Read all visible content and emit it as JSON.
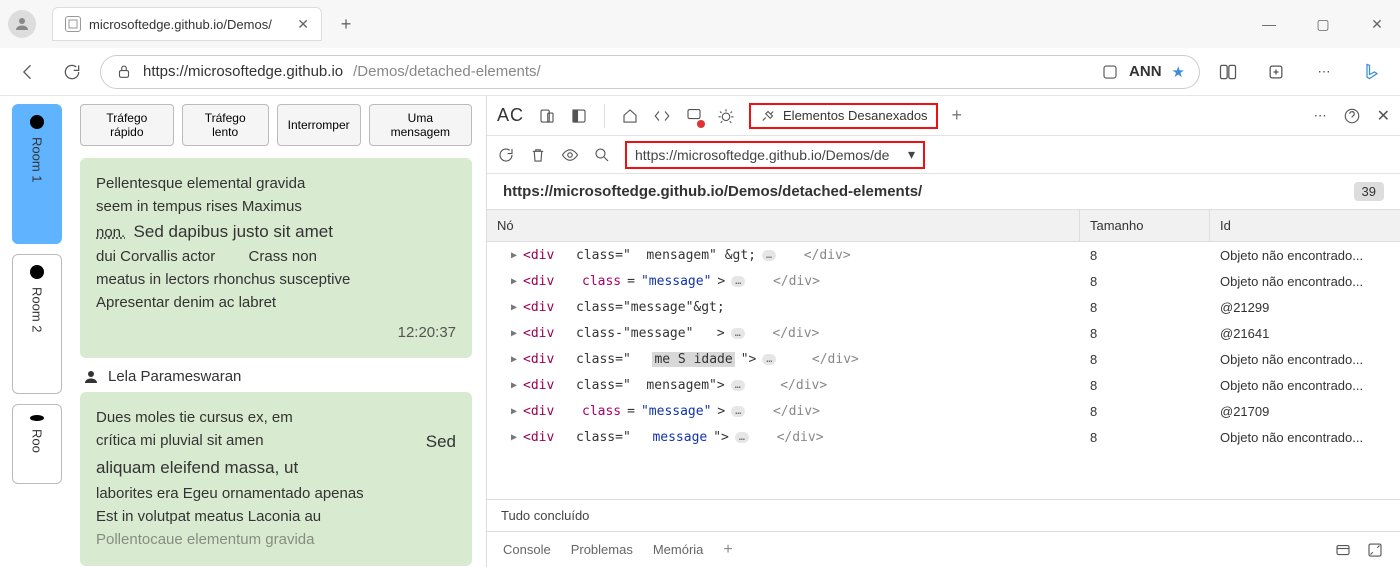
{
  "browser": {
    "tab_title": "microsoftedge.github.io/Demos/",
    "url_host": "https://microsoftedge.github.io",
    "url_path": "/Demos/detached-elements/",
    "profile_label": "ANN"
  },
  "app": {
    "rooms": [
      {
        "label": "Room 1",
        "active": true
      },
      {
        "label": "Room 2",
        "active": false
      },
      {
        "label": "Roo",
        "active": false
      }
    ],
    "buttons": {
      "fast": "Tráfego rápido",
      "slow": "Tráfego lento",
      "stop": "Interromper",
      "one": "Uma mensagem"
    },
    "msg1": {
      "line1": "Pellentesque elemental gravida",
      "line2": "seem in tempus rises Maximus",
      "line3a": "non.",
      "line3b": "Sed dapibus justo sit amet",
      "line4": "dui Corvallis actor        Crass non",
      "line5": "meatus in lectors rhonchus susceptive",
      "line6": "Apresentar denim ac labret",
      "time": "12:20:37"
    },
    "sender": "Lela Parameswaran",
    "msg2": {
      "line1": "Dues moles tie cursus ex, em",
      "line2a": "crítica mi pluvial sit amen",
      "line2b": "Sed",
      "line3": "aliquam eleifend massa, ut",
      "line4": "laborites era Egeu ornamentado apenas",
      "line5": "Est in volutpat meatus Laconia au",
      "line6": "Pollentocaue elementum gravida"
    }
  },
  "devtools": {
    "ac_label": "AC",
    "tab_detached": "Elementos Desanexados",
    "filter_text": "https://microsoftedge.github.io/Demos/de",
    "origin": "https://microsoftedge.github.io/Demos/detached-elements/",
    "count_badge": "39",
    "headers": {
      "node": "Nó",
      "size": "Tamanho",
      "id": "Id"
    },
    "rows": [
      {
        "node_html": "<span class='tag'>&lt;div</span>&nbsp;&nbsp;class=\"&nbsp;&nbsp;mensagem\" &amp;gt;<span class='pillmini'>…</span>&nbsp;&nbsp;<span class='gray'>&lt;/div&gt;</span>",
        "size": "8",
        "id": "Objeto não encontrado..."
      },
      {
        "node_html": "<span class='tag'>&lt;div</span>&nbsp;&nbsp;<span class='attrn'>class</span>=<span class='attrv'>\"message\"</span>&gt;<span class='pillmini'>…</span>&nbsp;&nbsp;<span class='gray'>&lt;/div&gt;</span>",
        "size": "8",
        "id": "Objeto não encontrado..."
      },
      {
        "node_html": "<span class='tag'>&lt;div</span>&nbsp;&nbsp;class=\"message\"&amp;gt;",
        "size": "8",
        "id": "@21299"
      },
      {
        "node_html": "<span class='tag'>&lt;div</span>&nbsp;&nbsp;class-\"message\"&nbsp;&nbsp;&nbsp;&gt;<span class='pillmini'>…</span>&nbsp;&nbsp;<span class='gray'>&lt;/div&gt;</span>",
        "size": "8",
        "id": "@21641"
      },
      {
        "node_html": "<span class='tag'>&lt;div</span>&nbsp;&nbsp;class=\"&nbsp;&nbsp;<span class='hl'>me S idade</span>\"&gt;<span class='pillmini'>…</span>&nbsp;&nbsp;&nbsp;<span class='gray'>&lt;/div&gt;</span>",
        "size": "8",
        "id": "Objeto não encontrado..."
      },
      {
        "node_html": "<span class='tag'>&lt;div</span>&nbsp;&nbsp;class=\"&nbsp;&nbsp;mensagem\"&gt;<span class='pillmini'>…</span>&nbsp;&nbsp;&nbsp;<span class='gray'>&lt;/div&gt;</span>",
        "size": "8",
        "id": "Objeto não encontrado..."
      },
      {
        "node_html": "<span class='tag'>&lt;div</span>&nbsp;&nbsp;<span class='attrn'>class</span>=<span class='attrv'>\"message\"</span>&gt;<span class='pillmini'>…</span>&nbsp;&nbsp;<span class='gray'>&lt;/div&gt;</span>",
        "size": "8",
        "id": "@21709"
      },
      {
        "node_html": "<span class='tag'>&lt;div</span>&nbsp;&nbsp;class=\"&nbsp;&nbsp;<span class='attrv'>message</span>\"&gt;<span class='pillmini'>…</span>&nbsp;&nbsp;<span class='gray'>&lt;/div&gt;</span>",
        "size": "8",
        "id": "Objeto não encontrado..."
      }
    ],
    "status": "Tudo concluído",
    "drawer": {
      "console": "Console",
      "problems": "Problemas",
      "memory": "Memória"
    }
  }
}
